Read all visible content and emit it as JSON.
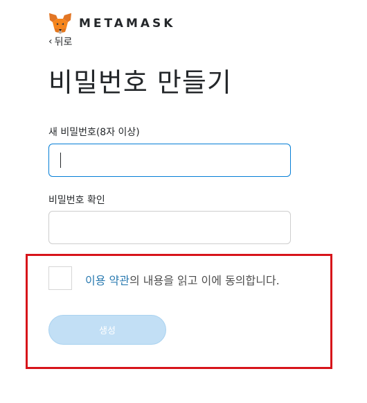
{
  "brand": {
    "wordmark": "METAMASK",
    "logo_icon": "metamask-fox-icon"
  },
  "nav": {
    "back_label": "뒤로",
    "back_icon": "chevron-left-icon"
  },
  "page": {
    "title": "비밀번호 만들기"
  },
  "form": {
    "new_password": {
      "label": "새 비밀번호(8자 이상)",
      "value": "",
      "placeholder": ""
    },
    "confirm_password": {
      "label": "비밀번호 확인",
      "value": "",
      "placeholder": ""
    },
    "terms": {
      "checked": false,
      "link_text": "이용 약관",
      "suffix_text": "의 내용을 읽고 이에 동의합니다."
    },
    "create_button": {
      "label": "생성",
      "disabled": true
    }
  },
  "colors": {
    "accent": "#037dd6",
    "link": "#2a7ab0",
    "button_disabled_bg": "#c2dff5",
    "highlight_border": "#d7141a"
  }
}
